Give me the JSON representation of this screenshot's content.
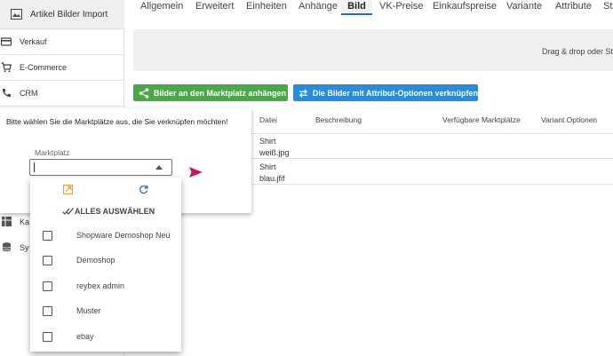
{
  "sidebar": {
    "header": {
      "label": "Artikel Bilder Import",
      "icon": "image-icon"
    },
    "items": [
      {
        "label": "Verkauf",
        "icon": "credit-card-icon"
      },
      {
        "label": "E-Commerce",
        "icon": "cart-icon"
      },
      {
        "label": "CRM",
        "icon": "phone-icon"
      }
    ],
    "obscured_items": [
      {
        "label": "Ka",
        "icon": "table-icon"
      },
      {
        "label": "Sy",
        "icon": "database-icon"
      }
    ]
  },
  "tabs": [
    {
      "label": "Allgemein"
    },
    {
      "label": "Erweitert"
    },
    {
      "label": "Einheiten"
    },
    {
      "label": "Anhänge"
    },
    {
      "label": "Bild",
      "active": true
    },
    {
      "label": "VK-Preise"
    },
    {
      "label": "Einkaufspreise"
    },
    {
      "label": "Variante"
    },
    {
      "label": "Attribute"
    },
    {
      "label": "St"
    }
  ],
  "dropzone": {
    "text": "Drag & drop oder St"
  },
  "buttons": {
    "attach_marketplace": "Bilder an den Marktplatz anhängen",
    "link_attributes": "Die Bilder mit Attribut-Optionen verknüpfen"
  },
  "table": {
    "headers": [
      "Datei",
      "Beschreibung",
      "Verfügbare Marktplätze",
      "Variant Optionen"
    ],
    "rows": [
      {
        "file_line1": "Shirt",
        "file_line2": "weiß.jpg"
      },
      {
        "file_line1": "Shirt",
        "file_line2": "blau.jfif"
      }
    ]
  },
  "popup": {
    "message": "Bitte wählen Sie die Marktplätze aus, die Sie verknüpfen möchten!",
    "field_label": "Marktplatz",
    "field_value": ""
  },
  "dropdown": {
    "select_all": "ALLES AUSWÄHLEN",
    "options": [
      {
        "label": "Shopware Demoshop Neu",
        "checked": false
      },
      {
        "label": "Demoshop",
        "checked": false
      },
      {
        "label": "reybex admin",
        "checked": false
      },
      {
        "label": "Muster",
        "checked": false
      },
      {
        "label": "ebay",
        "checked": false
      }
    ]
  },
  "colors": {
    "green_button": "#4aa84a",
    "blue_button": "#2a8bd8",
    "accent_icon_orange": "#f0a030",
    "send_icon": "#c0185a",
    "focus_border": "#3a7fd0"
  }
}
